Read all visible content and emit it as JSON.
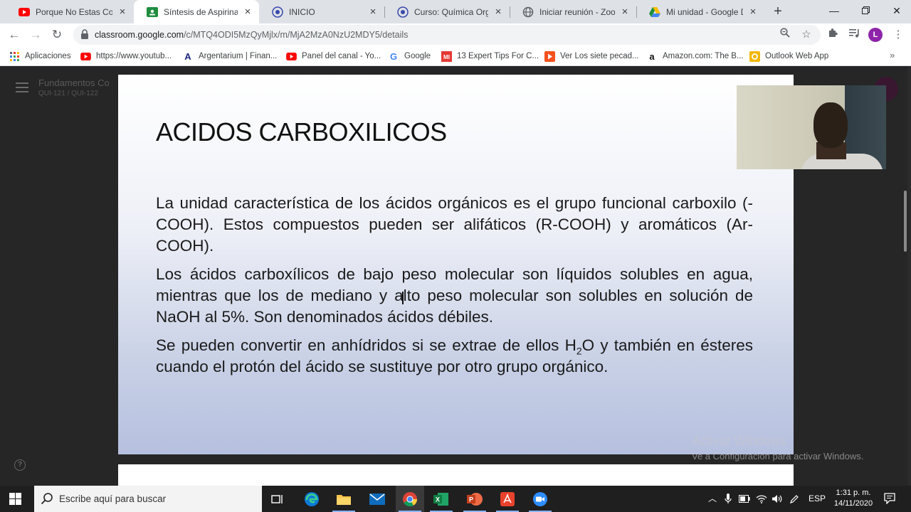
{
  "browser": {
    "tabs": [
      {
        "title": "Porque No Estas Conmigo",
        "icon": "youtube-icon",
        "active": false
      },
      {
        "title": "Síntesis de Aspirina",
        "icon": "google-classroom-icon",
        "active": true
      },
      {
        "title": "INICIO",
        "icon": "university-logo-icon",
        "active": false
      },
      {
        "title": "Curso: Química Orgánica",
        "icon": "university-logo-icon",
        "active": false
      },
      {
        "title": "Iniciar reunión - Zoom",
        "icon": "globe-icon",
        "active": false
      },
      {
        "title": "Mi unidad - Google Drive",
        "icon": "google-drive-icon",
        "active": false
      }
    ],
    "new_tab_label": "+",
    "url_host": "classroom.google.com",
    "url_path": "/c/MTQ4ODI5MzQyMjlx/m/MjA2MzA0NzU2MDY5/details",
    "avatar_letter": "L",
    "bookmarks": [
      {
        "label": "Aplicaciones",
        "icon": "apps-grid-icon"
      },
      {
        "label": "https://www.youtub...",
        "icon": "youtube-icon"
      },
      {
        "label": "Argentarium | Finan...",
        "icon": "argentarium-logo-icon"
      },
      {
        "label": "Panel del canal - Yo...",
        "icon": "youtube-icon"
      },
      {
        "label": "Google",
        "icon": "google-icon"
      },
      {
        "label": "13 Expert Tips For C...",
        "icon": "mi-logo-icon"
      },
      {
        "label": "Ver Los siete pecad...",
        "icon": "play-icon"
      },
      {
        "label": "Amazon.com: The B...",
        "icon": "amazon-icon"
      },
      {
        "label": "Outlook Web App",
        "icon": "outlook-icon"
      }
    ],
    "bookmarks_more": "»"
  },
  "classroom": {
    "course_title": "Fundamentos Co",
    "course_subtitle": "QUI-121 / QUI-122",
    "help_label": "?"
  },
  "slide": {
    "title": "ACIDOS CARBOXILICOS",
    "p1": "La unidad característica de los ácidos orgánicos es el grupo funcional carboxilo (-COOH).  Estos compuestos pueden ser alifáticos (R-COOH) y aromáticos (Ar-COOH).",
    "p2": "Los ácidos carboxílicos de bajo peso molecular son líquidos solubles en agua, mientras que los de mediano y alto peso molecular son solubles en solución de NaOH al 5%.  Son denominados ácidos débiles.",
    "p3_before": "Se pueden convertir en anhídridos si se extrae de ellos H",
    "p3_sub": "2",
    "p3_after": "O y también en ésteres cuando el protón del ácido se sustituye por otro grupo orgánico."
  },
  "watermark": {
    "line1": "Activar Windows",
    "line2": "Ve a Configuración para activar Windows."
  },
  "taskbar": {
    "search_placeholder": "Escribe aquí para buscar",
    "language": "ESP",
    "time": "1:31 p. m.",
    "date": "14/11/2020",
    "apps": [
      "task-view-icon",
      "edge-icon",
      "file-explorer-icon",
      "mail-icon",
      "chrome-icon",
      "excel-icon",
      "powerpoint-icon",
      "acrobat-icon",
      "zoom-icon"
    ]
  },
  "colors": {
    "chrome_tabstrip": "#dee1e6",
    "classroom_green": "#1e8e3e",
    "youtube_red": "#ff0000",
    "avatar_purple": "#8e24aa",
    "zoom_blue": "#2d8cff"
  }
}
